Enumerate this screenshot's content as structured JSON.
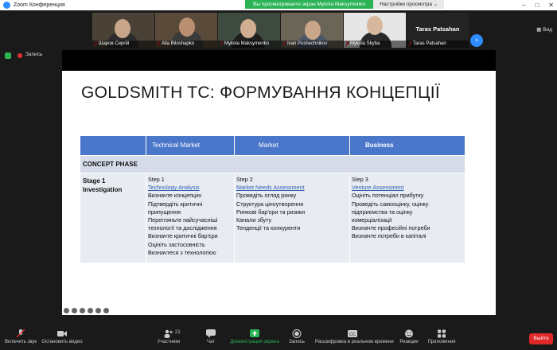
{
  "window": {
    "title": "Zoom Конференция"
  },
  "share_banner": {
    "message": "Вы просматриваете экран Mykola Maksymenko",
    "options_label": "Настройки просмотра ⌄"
  },
  "gallery": {
    "participants": [
      {
        "name": "Шаров Сергій",
        "muted": true
      },
      {
        "name": "Alla Biloshapko",
        "muted": true
      },
      {
        "name": "Mykola Maksymenko",
        "muted": true
      },
      {
        "name": "Ivan Pushechnikov",
        "muted": true
      },
      {
        "name": "Mykola Skyba",
        "muted": true
      },
      {
        "name": "Taras Patsahan",
        "muted": true
      }
    ],
    "view_label": "Вид"
  },
  "recording": {
    "label": "Запись"
  },
  "slide": {
    "title": "GOLDSMITH TC: ФОРМУВАННЯ КОНЦЕПЦІЇ",
    "header_color": "#4a77c9",
    "columns": [
      "Technical Market",
      "Market",
      "Business"
    ],
    "phase_label": "CONCEPT PHASE",
    "stage": {
      "label_line1": "Stage 1",
      "label_line2": "Investigation",
      "cols": [
        {
          "step": "Step 1",
          "link": "Technology Analysis",
          "items": [
            "Визначте концепцію",
            "Підтвердіть критичні",
            "припущення",
            "Перегляньте найсучасніші",
            "технології та дослідження",
            "Визначте критичні бар'єри",
            "Оцініть застосовність",
            "Визначтеся з технологією"
          ]
        },
        {
          "step": "Step 2",
          "link": "Market Needs Assessment",
          "items": [
            "Проведіть огляд ринку",
            "Структура ціноутворення",
            "Ринкові бар'єри та ризики",
            "Канали збуту",
            "Тенденції та конкуренти"
          ]
        },
        {
          "step": "Step 3",
          "link": "Venture Assessment",
          "items": [
            "Оцініть потенціал прибутку",
            "Проведіть самооцінку, оцінку",
            "підприємства та оцінку",
            "комерціалізації",
            "Визначте професійні потреби",
            "Визначте потреби в капіталі"
          ]
        }
      ]
    }
  },
  "toolbar": {
    "unmute": "Включить звук",
    "video": "Остановить видео",
    "participants": "Участники",
    "participants_count": "21",
    "chat": "Чат",
    "share": "Демонстрация экрана",
    "record": "Запись",
    "captions": "Расшифровка в реальном времени",
    "reactions": "Реакции",
    "apps": "Приложения",
    "leave": "Выйти",
    "share_color": "#2cb355",
    "leave_color": "#e02828"
  }
}
